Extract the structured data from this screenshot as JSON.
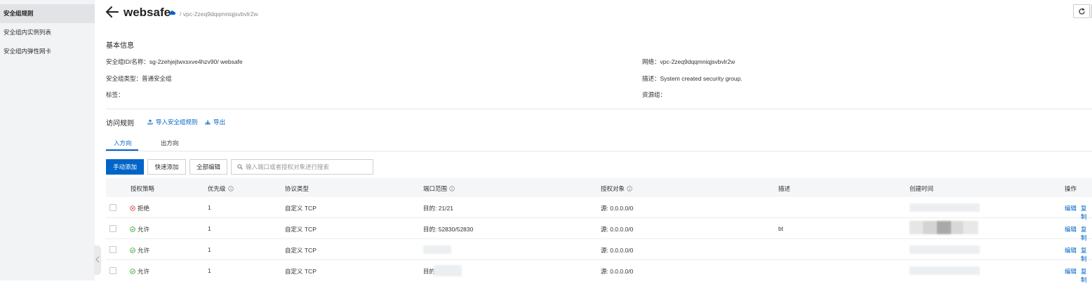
{
  "sidebar": {
    "items": [
      {
        "label": "安全组规则",
        "active": true
      },
      {
        "label": "安全组内实例列表",
        "active": false
      },
      {
        "label": "安全组内弹性网卡",
        "active": false
      }
    ]
  },
  "header": {
    "title": "websafe",
    "breadcrumb": "/ vpc-2zeq9dqqmniqjsvbvlr2w"
  },
  "basic_info": {
    "section_title": "基本信息",
    "id_name_label": "安全组ID/名称：",
    "id_name_value": "sg-2zehjejtwxsxve4hzv90/ websafe",
    "type_label": "安全组类型：",
    "type_value": "普通安全组",
    "tags_label": "标签：",
    "network_label": "网络：",
    "network_value": "vpc-2zeq9dqqmniqjsvbvlr2w",
    "desc_label": "描述：",
    "desc_value": "System created security group.",
    "resource_group_label": "资源组："
  },
  "access_rules": {
    "section_title": "访问规则",
    "import_label": "导入安全组规则",
    "export_label": "导出",
    "tabs": [
      {
        "label": "入方向",
        "active": true
      },
      {
        "label": "出方向",
        "active": false
      }
    ],
    "buttons": {
      "manual_add": "手动添加",
      "quick_add": "快速添加",
      "edit_all": "全部编辑"
    },
    "search_placeholder": "输入端口或者授权对象进行搜索"
  },
  "table": {
    "columns": [
      "授权策略",
      "优先级",
      "协议类型",
      "端口范围",
      "授权对象",
      "描述",
      "创建时间",
      "操作"
    ],
    "rows": [
      {
        "policy": "拒绝",
        "policy_status": "deny",
        "priority": "1",
        "protocol": "自定义 TCP",
        "port": "目的: 21/21",
        "target": "源: 0.0.0.0/0",
        "description": "",
        "edit": "编辑",
        "copy": "复制"
      },
      {
        "policy": "允许",
        "policy_status": "allow",
        "priority": "1",
        "protocol": "自定义 TCP",
        "port": "目的: 52830/52830",
        "target": "源: 0.0.0.0/0",
        "description": "bt",
        "edit": "编辑",
        "copy": "复制"
      },
      {
        "policy": "允许",
        "policy_status": "allow",
        "priority": "1",
        "protocol": "自定义 TCP",
        "port": "",
        "target": "源: 0.0.0.0/0",
        "description": "",
        "edit": "编辑",
        "copy": "复制"
      },
      {
        "policy": "允许",
        "policy_status": "allow",
        "priority": "1",
        "protocol": "自定义 TCP",
        "port": "目的",
        "target": "源: 0.0.0.0/0",
        "description": "",
        "edit": "编辑",
        "copy": "复制"
      }
    ]
  },
  "colors": {
    "primary": "#0064c8",
    "deny": "#e0383e",
    "allow": "#2ea12e"
  }
}
